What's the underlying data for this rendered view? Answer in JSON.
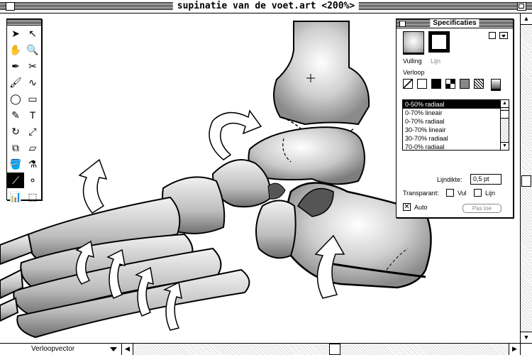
{
  "window": {
    "title": "supinatie van de voet.art <200%>"
  },
  "status_menu": {
    "label": "Verloopvector"
  },
  "toolbox": {
    "tools": [
      {
        "name": "arrow-tool",
        "glyph": "➤"
      },
      {
        "name": "direct-select-tool",
        "glyph": "↖"
      },
      {
        "name": "hand-tool",
        "glyph": "✋"
      },
      {
        "name": "zoom-tool",
        "glyph": "🔍"
      },
      {
        "name": "pen-tool",
        "glyph": "✒"
      },
      {
        "name": "scissors-tool",
        "glyph": "✂"
      },
      {
        "name": "brush-tool",
        "glyph": "🖌"
      },
      {
        "name": "freehand-tool",
        "glyph": "∿"
      },
      {
        "name": "ellipse-tool",
        "glyph": "◯"
      },
      {
        "name": "rectangle-tool",
        "glyph": "▭"
      },
      {
        "name": "knife-tool",
        "glyph": "✎"
      },
      {
        "name": "text-tool",
        "glyph": "T"
      },
      {
        "name": "rotate-tool",
        "glyph": "↻"
      },
      {
        "name": "scale-tool",
        "glyph": "⤢"
      },
      {
        "name": "reflect-tool",
        "glyph": "⧉"
      },
      {
        "name": "shear-tool",
        "glyph": "▱"
      },
      {
        "name": "paint-bucket-tool",
        "glyph": "🪣"
      },
      {
        "name": "eyedropper-tool",
        "glyph": "⚗"
      },
      {
        "name": "gradient-vector-tool",
        "glyph": "⟋"
      },
      {
        "name": "blend-tool",
        "glyph": "⚬"
      },
      {
        "name": "graph-tool",
        "glyph": "📊"
      },
      {
        "name": "page-tool",
        "glyph": "⬚"
      }
    ]
  },
  "spec": {
    "title": "Specificaties",
    "fill_label": "Vulling",
    "stroke_label": "Lijn",
    "gradient_label": "Verloop",
    "gradients": [
      "0-50% radiaal",
      "0-70% lineair",
      "0-70% radiaal",
      "30-70% lineair",
      "30-70% radiaal",
      "70-0% radiaal"
    ],
    "line_width_label": "Lijndikte:",
    "line_width_value": "0,5 pt",
    "transparent_label": "Transparant:",
    "fill_check_label": "Vul",
    "line_check_label": "Lijn",
    "auto_label": "Auto",
    "apply_button": "Pas toe"
  }
}
